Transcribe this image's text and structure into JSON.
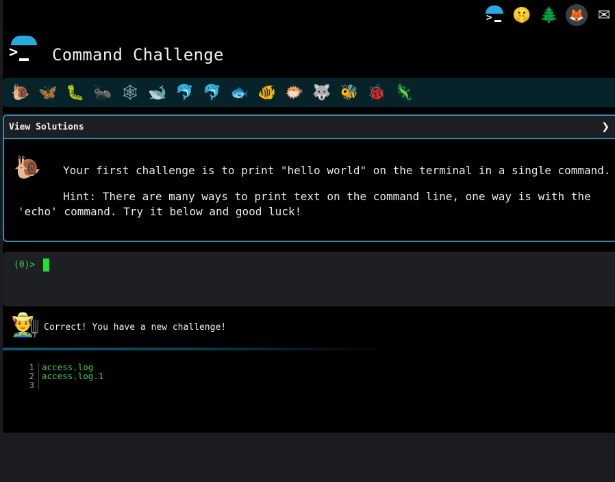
{
  "header": {
    "title": "Command Challenge",
    "top_icons": [
      "terminal-logo-icon",
      "shushing-face-icon",
      "tree-icon",
      "gitlab-icon",
      "envelope-icon"
    ]
  },
  "levels": [
    {
      "icon": "snail-icon",
      "glyph": "🐌"
    },
    {
      "icon": "butterfly-icon",
      "glyph": "🦋"
    },
    {
      "icon": "caterpillar-icon",
      "glyph": "🐛"
    },
    {
      "icon": "ant-icon",
      "glyph": "🐜"
    },
    {
      "icon": "spider-web-icon",
      "glyph": "🕸"
    },
    {
      "icon": "whale-icon",
      "glyph": "🐋"
    },
    {
      "icon": "dolphin-icon",
      "glyph": "🐬"
    },
    {
      "icon": "shark-icon",
      "glyph": "🐬"
    },
    {
      "icon": "fish-icon",
      "glyph": "🐟"
    },
    {
      "icon": "tropical-fish-icon",
      "glyph": "🐠"
    },
    {
      "icon": "pufferfish-icon",
      "glyph": "🐡"
    },
    {
      "icon": "wolf-icon",
      "glyph": "🐺"
    },
    {
      "icon": "bee-icon",
      "glyph": "🐝"
    },
    {
      "icon": "ladybug-icon",
      "glyph": "🐞"
    },
    {
      "icon": "lizard-icon",
      "glyph": "🦎"
    }
  ],
  "solutions": {
    "label": "View Solutions",
    "chevron": "❯"
  },
  "challenge": {
    "icon": "snail-icon",
    "glyph": "🐌",
    "text": "Your first challenge is to print \"hello world\" on the terminal in a single command.",
    "hint": "Hint: There are many ways to print text on the command line, one way is with the 'echo' command. Try it below and good luck!"
  },
  "terminal": {
    "prompt": "(0)>"
  },
  "feedback": {
    "avatar": "person-icon",
    "glyph": "👨‍🌾",
    "text": "Correct! You have a new challenge!"
  },
  "output": {
    "lines": [
      {
        "num": "1",
        "text": "access.log"
      },
      {
        "num": "2",
        "text": "access.log.1"
      },
      {
        "num": "3",
        "text": ""
      }
    ]
  },
  "colors": {
    "accent": "#2a8fb3",
    "prompt_green": "#39d353",
    "strip_bg": "#062329"
  }
}
